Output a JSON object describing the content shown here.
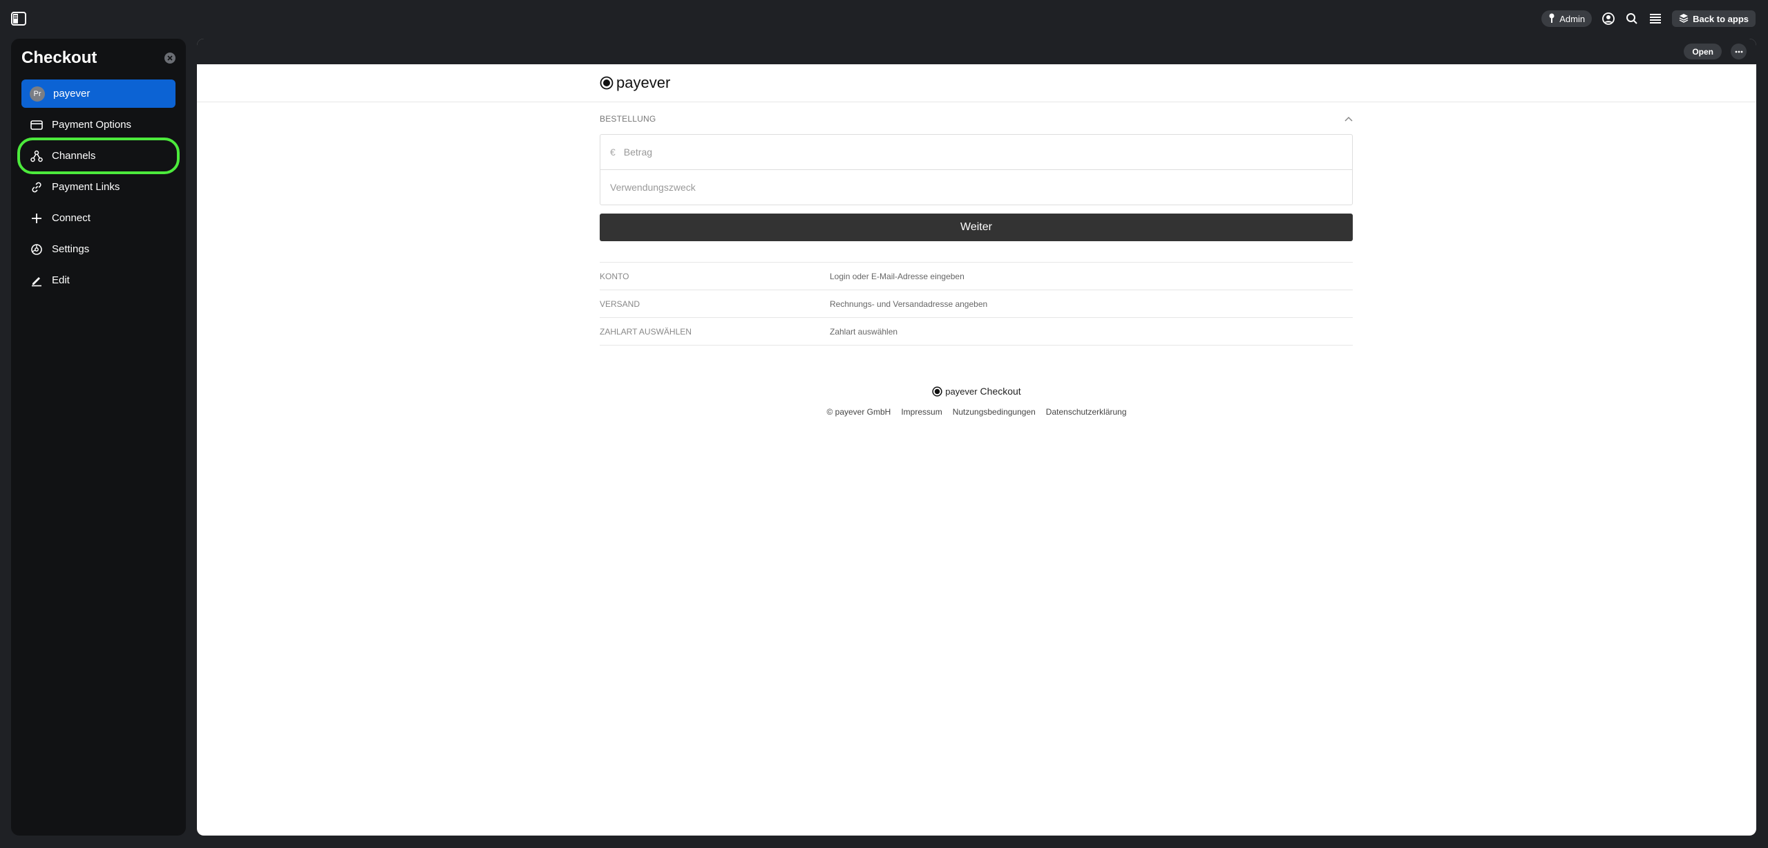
{
  "topbar": {
    "admin_label": "Admin",
    "back_label": "Back to apps"
  },
  "sidebar": {
    "title": "Checkout",
    "items": [
      {
        "label": "payever",
        "avatar": "Pr"
      },
      {
        "label": "Payment Options"
      },
      {
        "label": "Channels"
      },
      {
        "label": "Payment Links"
      },
      {
        "label": "Connect"
      },
      {
        "label": "Settings"
      },
      {
        "label": "Edit"
      }
    ]
  },
  "main": {
    "open_label": "Open",
    "logo_text": "payever",
    "section_title": "BESTELLUNG",
    "amount_placeholder": "Betrag",
    "currency": "€",
    "purpose_placeholder": "Verwendungszweck",
    "continue_label": "Weiter",
    "steps": [
      {
        "title": "KONTO",
        "desc": "Login oder E-Mail-Adresse eingeben"
      },
      {
        "title": "VERSAND",
        "desc": "Rechnungs- und Versandadresse angeben"
      },
      {
        "title": "ZAHLART AUSWÄHLEN",
        "desc": "Zahlart auswählen"
      }
    ],
    "footer": {
      "brand": "payever",
      "product": "Checkout",
      "links": [
        "© payever GmbH",
        "Impressum",
        "Nutzungsbedingungen",
        "Datenschutzerklärung"
      ]
    }
  },
  "colors": {
    "accent": "#0c63d4",
    "highlight": "#4cea3c",
    "background": "#1f2125",
    "sidebar": "#111214"
  }
}
